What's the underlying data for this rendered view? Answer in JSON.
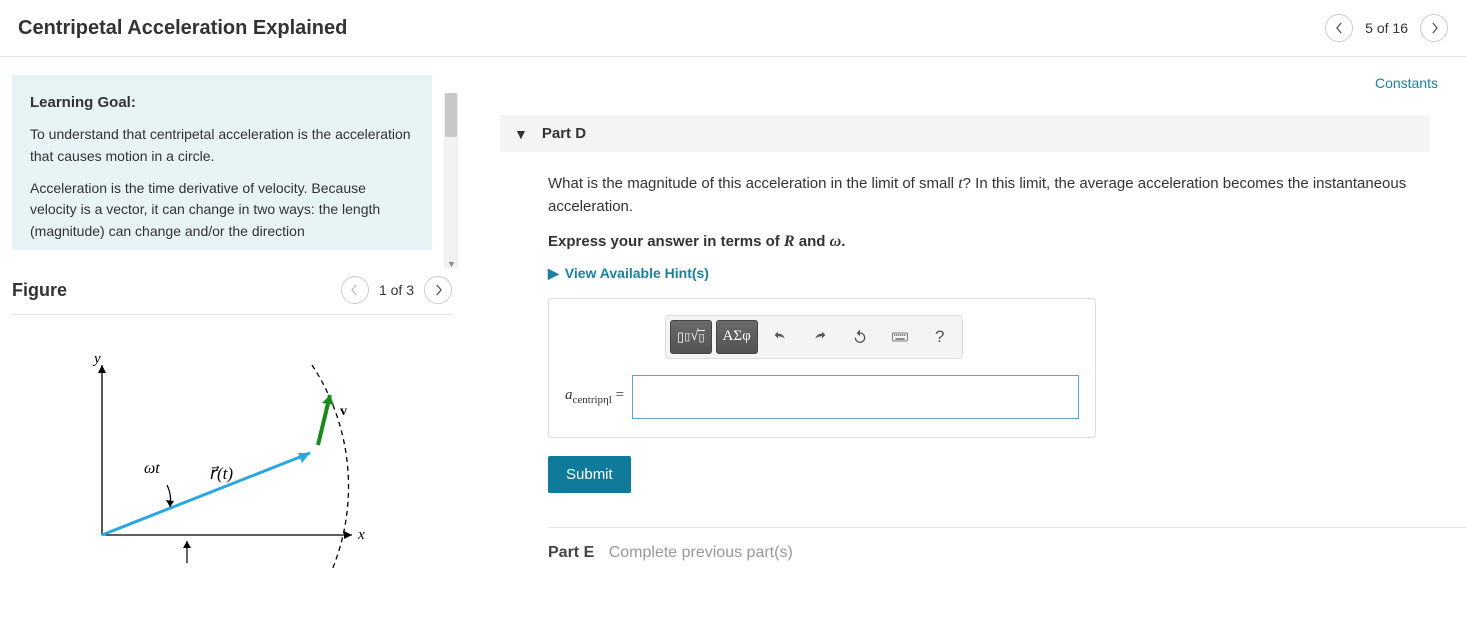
{
  "header": {
    "title": "Centripetal Acceleration Explained",
    "pager": "5 of 16"
  },
  "left": {
    "learning_goal_title": "Learning Goal:",
    "learning_goal_p1": "To understand that centripetal acceleration is the acceleration that causes motion in a circle.",
    "learning_goal_p2": "Acceleration is the time derivative of velocity. Because velocity is a vector, it can change in two ways: the length (magnitude) can change and/or the direction",
    "figure_title": "Figure",
    "figure_pager": "1 of 3",
    "figure_labels": {
      "y": "y",
      "x": "x",
      "v": "v",
      "wt": "ωt",
      "rt": "r⃗(t)"
    }
  },
  "right": {
    "constants": "Constants",
    "partD": {
      "label": "Part D",
      "question_before_t": "What is the magnitude of this acceleration in the limit of small ",
      "t": "t",
      "question_after_t": "? In this limit, the average acceleration becomes the instantaneous acceleration.",
      "express_before": "Express your answer in terms of ",
      "R": "R",
      "and": " and ",
      "omega": "ω",
      "period": ".",
      "hints": "View Available Hint(s)",
      "answer_var": "a",
      "answer_sub": "centripηl",
      "equals": " = ",
      "submit": "Submit"
    },
    "partE": {
      "label": "Part E",
      "text": "Complete previous part(s)"
    },
    "toolbar": {
      "templates": "▢√▢",
      "greek": "ΑΣφ",
      "help": "?"
    }
  }
}
